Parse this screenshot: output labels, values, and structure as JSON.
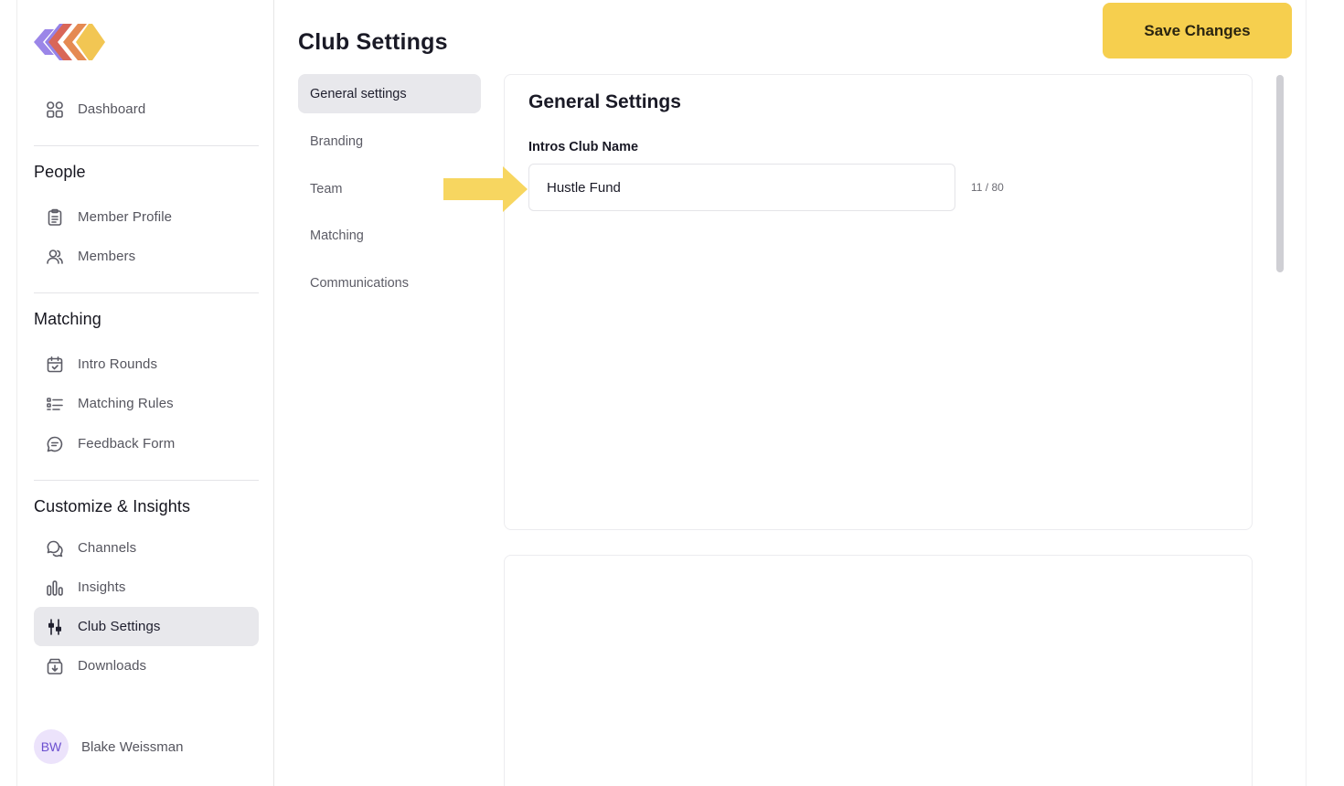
{
  "sidebar": {
    "dashboard": "Dashboard",
    "sections": {
      "people": "People",
      "matching": "Matching",
      "customize": "Customize & Insights"
    },
    "items": {
      "member_profile": "Member Profile",
      "members": "Members",
      "intro_rounds": "Intro Rounds",
      "matching_rules": "Matching Rules",
      "feedback_form": "Feedback Form",
      "channels": "Channels",
      "insights": "Insights",
      "club_settings": "Club Settings",
      "downloads": "Downloads"
    },
    "active_item": "Club Settings",
    "user": {
      "initials": "BW",
      "name": "Blake Weissman"
    }
  },
  "header": {
    "title": "Club Settings",
    "save_label": "Save Changes"
  },
  "subnav": {
    "items": [
      "General settings",
      "Branding",
      "Team",
      "Matching",
      "Communications"
    ],
    "active": "General settings"
  },
  "general_card": {
    "title": "General Settings",
    "field_label": "Intros Club Name",
    "field_value": "Hustle Fund",
    "char_count": "11 / 80"
  },
  "colors": {
    "accent": "#f6cf4e",
    "active_bg": "#e8e8ec",
    "avatar_bg": "#ece3fb",
    "arrow": "#f7d660"
  },
  "icons": {
    "dashboard": "grid-icon",
    "member_profile": "clipboard-icon",
    "members": "users-icon",
    "intro_rounds": "calendar-check-icon",
    "matching_rules": "list-icon",
    "feedback_form": "chat-bubble-icon",
    "channels": "chat-bubbles-icon",
    "insights": "bar-chart-icon",
    "club_settings": "sliders-icon",
    "downloads": "archive-download-icon"
  }
}
